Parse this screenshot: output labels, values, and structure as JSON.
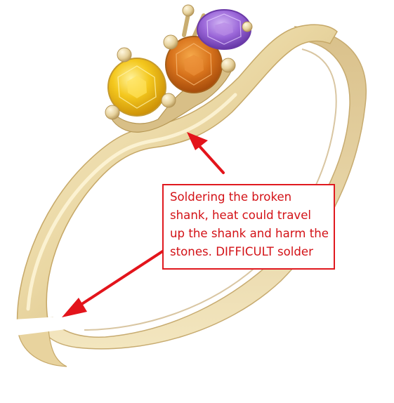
{
  "image": {
    "subject": "yellow-gold ring with yellow, orange and purple stones",
    "colors": {
      "background": "#ffffff",
      "gold_light": "#f6ebc6",
      "gold_mid": "#e4cf97",
      "gold_dark": "#b99a5a",
      "stone_yellow": "#f3c51a",
      "stone_orange": "#d9731c",
      "stone_purple": "#8e5ad0",
      "annotation_red": "#e0191f"
    }
  },
  "annotation": {
    "text": "Soldering the broken shank, heat could travel up the shank and harm the stones. DIFFICULT solder"
  }
}
